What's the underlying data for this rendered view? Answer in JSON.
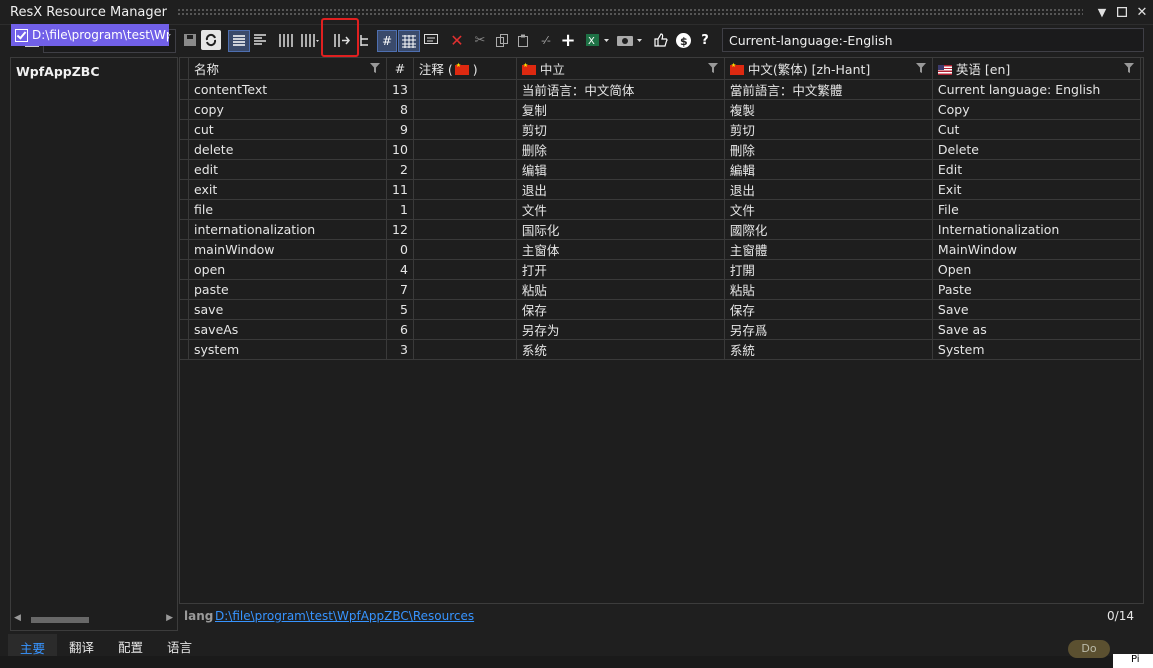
{
  "window": {
    "title": "ResX Resource Manager",
    "menu_icon": "chevron-down-icon",
    "maximize_icon": "maximize-icon",
    "close_icon": "close-icon"
  },
  "toolbar": {
    "language_label": "Current-language:-English",
    "buttons": [
      "save-icon",
      "refresh-icon",
      "list-view-icon",
      "align-icon",
      "columns-icon",
      "column-chooser-icon",
      "add-column-icon",
      "hierarchy-icon",
      "hash-icon",
      "grid-icon",
      "comment-icon",
      "delete-icon",
      "cut-icon",
      "copy-icon",
      "paste-icon",
      "invariant-icon",
      "add-icon",
      "excel-icon",
      "snapshot-icon",
      "like-icon",
      "donate-icon",
      "help-icon"
    ]
  },
  "project": {
    "name": "WpfAppZBC",
    "item": "D:\\file\\program\\test\\WpfAppZBC\\Resources"
  },
  "grid": {
    "columns": [
      {
        "label": "名称"
      },
      {
        "label": "#"
      },
      {
        "label": "注释 (",
        "flag": "cn",
        "suffix": ")"
      },
      {
        "label": "中立",
        "flag": "cn"
      },
      {
        "label": "中文(繁体) [zh-Hant]",
        "flag": "cn"
      },
      {
        "label": "英语 [en]",
        "flag": "us"
      }
    ],
    "rows": [
      [
        "contentText",
        "13",
        "",
        "当前语言：中文简体",
        "當前語言：中文繁體",
        "Current language: English"
      ],
      [
        "copy",
        "8",
        "",
        "复制",
        "複製",
        "Copy"
      ],
      [
        "cut",
        "9",
        "",
        "剪切",
        "剪切",
        "Cut"
      ],
      [
        "delete",
        "10",
        "",
        "删除",
        "刪除",
        "Delete"
      ],
      [
        "edit",
        "2",
        "",
        "编辑",
        "編輯",
        "Edit"
      ],
      [
        "exit",
        "11",
        "",
        "退出",
        "退出",
        "Exit"
      ],
      [
        "file",
        "1",
        "",
        "文件",
        "文件",
        "File"
      ],
      [
        "internationalization",
        "12",
        "",
        "国际化",
        "國際化",
        "Internationalization"
      ],
      [
        "mainWindow",
        "0",
        "",
        "主窗体",
        "主窗體",
        "MainWindow"
      ],
      [
        "open",
        "4",
        "",
        "打开",
        "打開",
        "Open"
      ],
      [
        "paste",
        "7",
        "",
        "粘贴",
        "粘貼",
        "Paste"
      ],
      [
        "save",
        "5",
        "",
        "保存",
        "保存",
        "Save"
      ],
      [
        "saveAs",
        "6",
        "",
        "另存为",
        "另存爲",
        "Save as"
      ],
      [
        "system",
        "3",
        "",
        "系统",
        "系統",
        "System"
      ]
    ]
  },
  "status": {
    "lang_label": "lang",
    "path": "D:\\file\\program\\test\\WpfAppZBC\\Resources",
    "count": "0/14"
  },
  "tabs": [
    "主要",
    "翻译",
    "配置",
    "语言"
  ],
  "background": {
    "do_label": "Do",
    "pi_label": "Pi"
  }
}
